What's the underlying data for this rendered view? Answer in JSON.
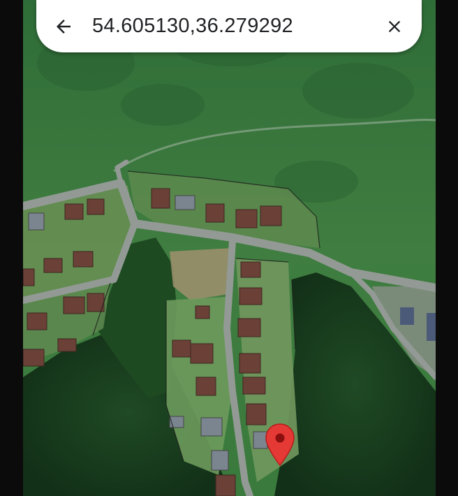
{
  "search": {
    "query": "54.605130,36.279292"
  },
  "icons": {
    "back": "arrow-back-icon",
    "close": "close-icon",
    "pin": "location-pin-icon"
  },
  "colors": {
    "pin": "#e53935",
    "pin_dot": "#8b0f0f",
    "field": "#3c7a3e",
    "forest": "#173d1d",
    "road": "#8e9591"
  }
}
